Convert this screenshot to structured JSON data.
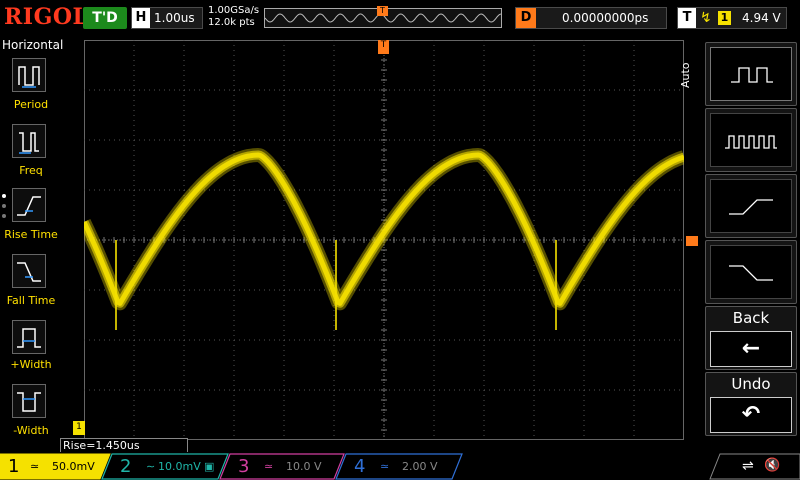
{
  "brand": {
    "logo": "RIGOL"
  },
  "status": {
    "run_state": "T'D"
  },
  "timebase": {
    "key": "H",
    "value": "1.00us"
  },
  "acquisition": {
    "sample_rate": "1.00GSa/s",
    "memory": "12.0k pts"
  },
  "trigger_position_glyph": "T",
  "delay": {
    "key": "D",
    "value": "0.00000000ps"
  },
  "trigger": {
    "key": "T",
    "edge_glyph": "↯",
    "source": "1",
    "level": "4.94 V"
  },
  "left_menu": {
    "title": "Horizontal",
    "items": [
      {
        "label": "Period",
        "icon": "period-icon"
      },
      {
        "label": "Freq",
        "icon": "freq-icon"
      },
      {
        "label": "Rise Time",
        "icon": "rise-time-icon"
      },
      {
        "label": "Fall Time",
        "icon": "fall-time-icon"
      },
      {
        "label": "+Width",
        "icon": "positive-width-icon"
      },
      {
        "label": "-Width",
        "icon": "negative-width-icon"
      }
    ]
  },
  "right_menu": {
    "title": "Auto",
    "items": [
      {
        "icon": "single-pulse-icon"
      },
      {
        "icon": "multi-pulse-icon"
      },
      {
        "icon": "rising-edge-icon"
      },
      {
        "icon": "falling-edge-icon"
      },
      {
        "label": "Back",
        "icon": "arrow-left-icon",
        "glyph": "←"
      },
      {
        "label": "Undo",
        "icon": "undo-icon",
        "glyph": "↶"
      }
    ]
  },
  "measurement": {
    "text": "Rise=1.450us"
  },
  "channels": [
    {
      "number": "1",
      "coupling": "≃",
      "scale": "50.0mV",
      "color": "#f5e100"
    },
    {
      "number": "2",
      "coupling": "∼",
      "scale": "10.0mV",
      "extra": "▣",
      "color": "#1fb5a8"
    },
    {
      "number": "3",
      "coupling": "≃",
      "scale": "10.0 V",
      "color": "#d13fa0"
    },
    {
      "number": "4",
      "coupling": "≃",
      "scale": "2.00 V",
      "color": "#2f6fd6"
    }
  ],
  "markers": {
    "ch1_ground": "1",
    "trigger_top": "T"
  },
  "colors": {
    "ch1": "#f5e100",
    "trigger": "#ff7a1a",
    "run": "#1c8a1c",
    "logo": "#ff3a1f",
    "grid": "#555555"
  },
  "usb": {
    "glyph": "⇌",
    "sound": "🔇"
  }
}
